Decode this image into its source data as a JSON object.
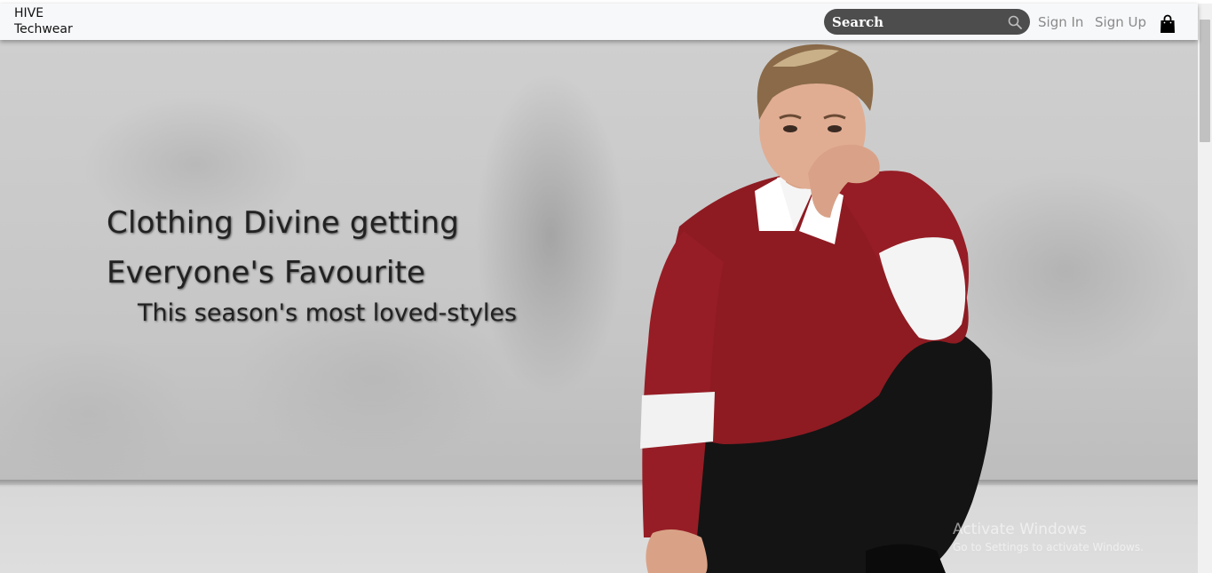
{
  "navbar": {
    "brand_line1": "HIVE",
    "brand_line2": "Techwear",
    "search_placeholder": "Search",
    "signin_label": "Sign In",
    "signup_label": "Sign Up"
  },
  "hero": {
    "headline_line1": "Clothing Divine getting",
    "headline_line2": "Everyone's Favourite",
    "tagline": "This season's most loved-styles"
  },
  "watermark": {
    "title": "Activate Windows",
    "subtitle": "Go to Settings to activate Windows."
  },
  "icons": {
    "search": "search-icon",
    "bag": "shopping-bag-icon"
  },
  "colors": {
    "navbar_bg": "#f7f8fa",
    "search_bg": "#4d4d4d",
    "nav_link": "#8a8a8a",
    "headline_text": "#222222"
  }
}
